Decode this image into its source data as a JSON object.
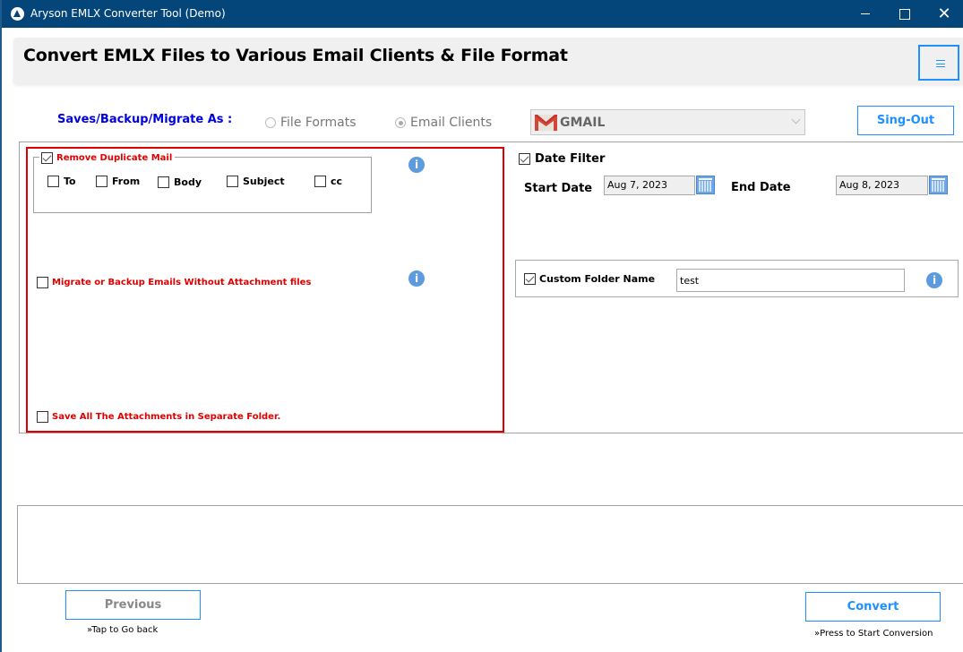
{
  "window": {
    "title": "Aryson EMLX Converter Tool (Demo)",
    "close_glyph": "✕"
  },
  "header": {
    "title": "Convert EMLX Files to Various Email Clients & File Format"
  },
  "save_as": {
    "label": "Saves/Backup/Migrate As :",
    "options": [
      {
        "label": "File Formats",
        "selected": false
      },
      {
        "label": "Email Clients",
        "selected": true
      }
    ],
    "client_select": {
      "value": "GMAIL",
      "icon": "gmail-icon"
    },
    "signout_label": "Sing-Out"
  },
  "options": {
    "remove_duplicate": {
      "label": "Remove Duplicate Mail",
      "checked": true,
      "fields": [
        {
          "label": "To",
          "checked": false
        },
        {
          "label": "From",
          "checked": false
        },
        {
          "label": "Body",
          "checked": false
        },
        {
          "label": "Subject",
          "checked": false
        },
        {
          "label": "cc",
          "checked": false
        }
      ]
    },
    "without_attachments": {
      "label": "Migrate or Backup Emails Without Attachment files",
      "checked": false
    },
    "separate_attachments": {
      "label": "Save All The Attachments in Separate Folder.",
      "checked": false
    },
    "info_glyph": "i"
  },
  "date_filter": {
    "label": "Date Filter",
    "checked": true,
    "start_label": "Start Date",
    "start_value": "Aug 7, 2023",
    "end_label": "End Date",
    "end_value": "Aug 8, 2023"
  },
  "custom_folder": {
    "label": "Custom Folder Name",
    "checked": true,
    "value": "test"
  },
  "footer": {
    "previous_label": "Previous",
    "previous_hint": "»Tap to Go back",
    "convert_label": "Convert",
    "convert_hint": "»Press to Start Conversion"
  }
}
